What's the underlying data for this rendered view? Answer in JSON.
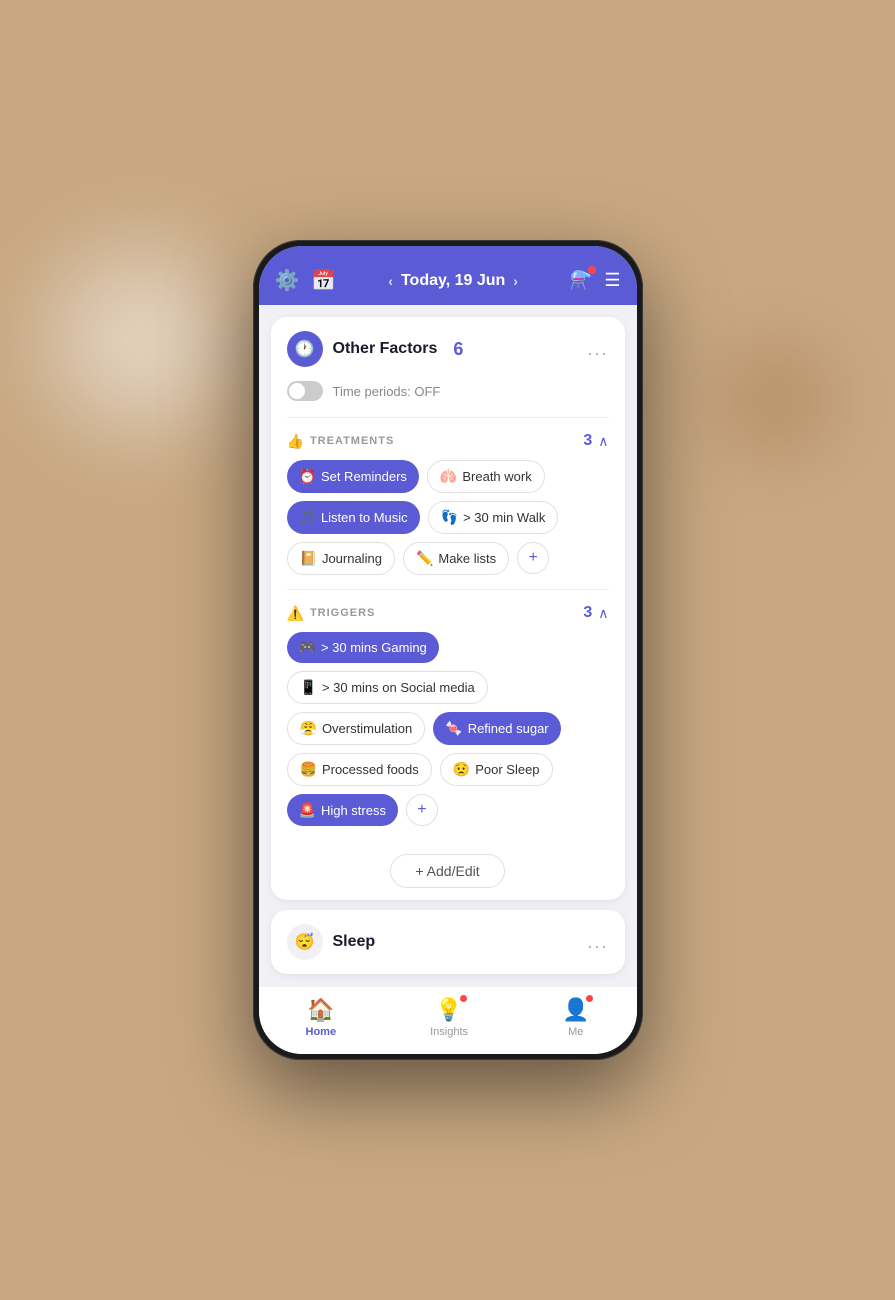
{
  "background": {
    "color": "#c8a882"
  },
  "header": {
    "left_icons": [
      "⚙️",
      "📅"
    ],
    "date": "Today, 19 Jun",
    "right_icons": [
      "flask",
      "menu"
    ]
  },
  "other_factors_card": {
    "icon": "🕐",
    "title": "Other Factors",
    "count": "6",
    "more_label": "...",
    "time_periods_label": "Time periods: OFF"
  },
  "treatments_section": {
    "icon": "👍",
    "title": "TREATMENTS",
    "count": "3",
    "tags": [
      {
        "emoji": "⏰",
        "label": "Set Reminders",
        "style": "purple"
      },
      {
        "emoji": "🫁",
        "label": "Breath work",
        "style": "outline"
      },
      {
        "emoji": "🎵",
        "label": "Listen to Music",
        "style": "purple"
      },
      {
        "emoji": "👣",
        "label": "> 30 min Walk",
        "style": "outline"
      },
      {
        "emoji": "📔",
        "label": "Journaling",
        "style": "outline"
      },
      {
        "emoji": "✏️",
        "label": "Make lists",
        "style": "outline"
      }
    ],
    "add_label": "+"
  },
  "triggers_section": {
    "icon": "⚠️",
    "title": "TRIGGERS",
    "count": "3",
    "tags": [
      {
        "emoji": "🎮",
        "label": "> 30 mins Gaming",
        "style": "purple"
      },
      {
        "emoji": "📱",
        "label": "> 30 mins on Social media",
        "style": "outline"
      },
      {
        "emoji": "😤",
        "label": "Overstimulation",
        "style": "outline"
      },
      {
        "emoji": "🍬",
        "label": "Refined sugar",
        "style": "purple"
      },
      {
        "emoji": "🍔",
        "label": "Processed foods",
        "style": "outline"
      },
      {
        "emoji": "😟",
        "label": "Poor Sleep",
        "style": "outline"
      },
      {
        "emoji": "🚨",
        "label": "High stress",
        "style": "purple"
      }
    ],
    "add_label": "+"
  },
  "add_edit_button": {
    "label": "+ Add/Edit"
  },
  "sleep_card": {
    "icon": "😴",
    "title": "Sleep",
    "more_label": "..."
  },
  "bottom_nav": {
    "items": [
      {
        "icon": "🏠",
        "label": "Home",
        "active": true
      },
      {
        "icon": "💡",
        "label": "Insights",
        "active": false,
        "badge": true
      },
      {
        "icon": "👤",
        "label": "Me",
        "active": false,
        "badge": true
      }
    ]
  }
}
